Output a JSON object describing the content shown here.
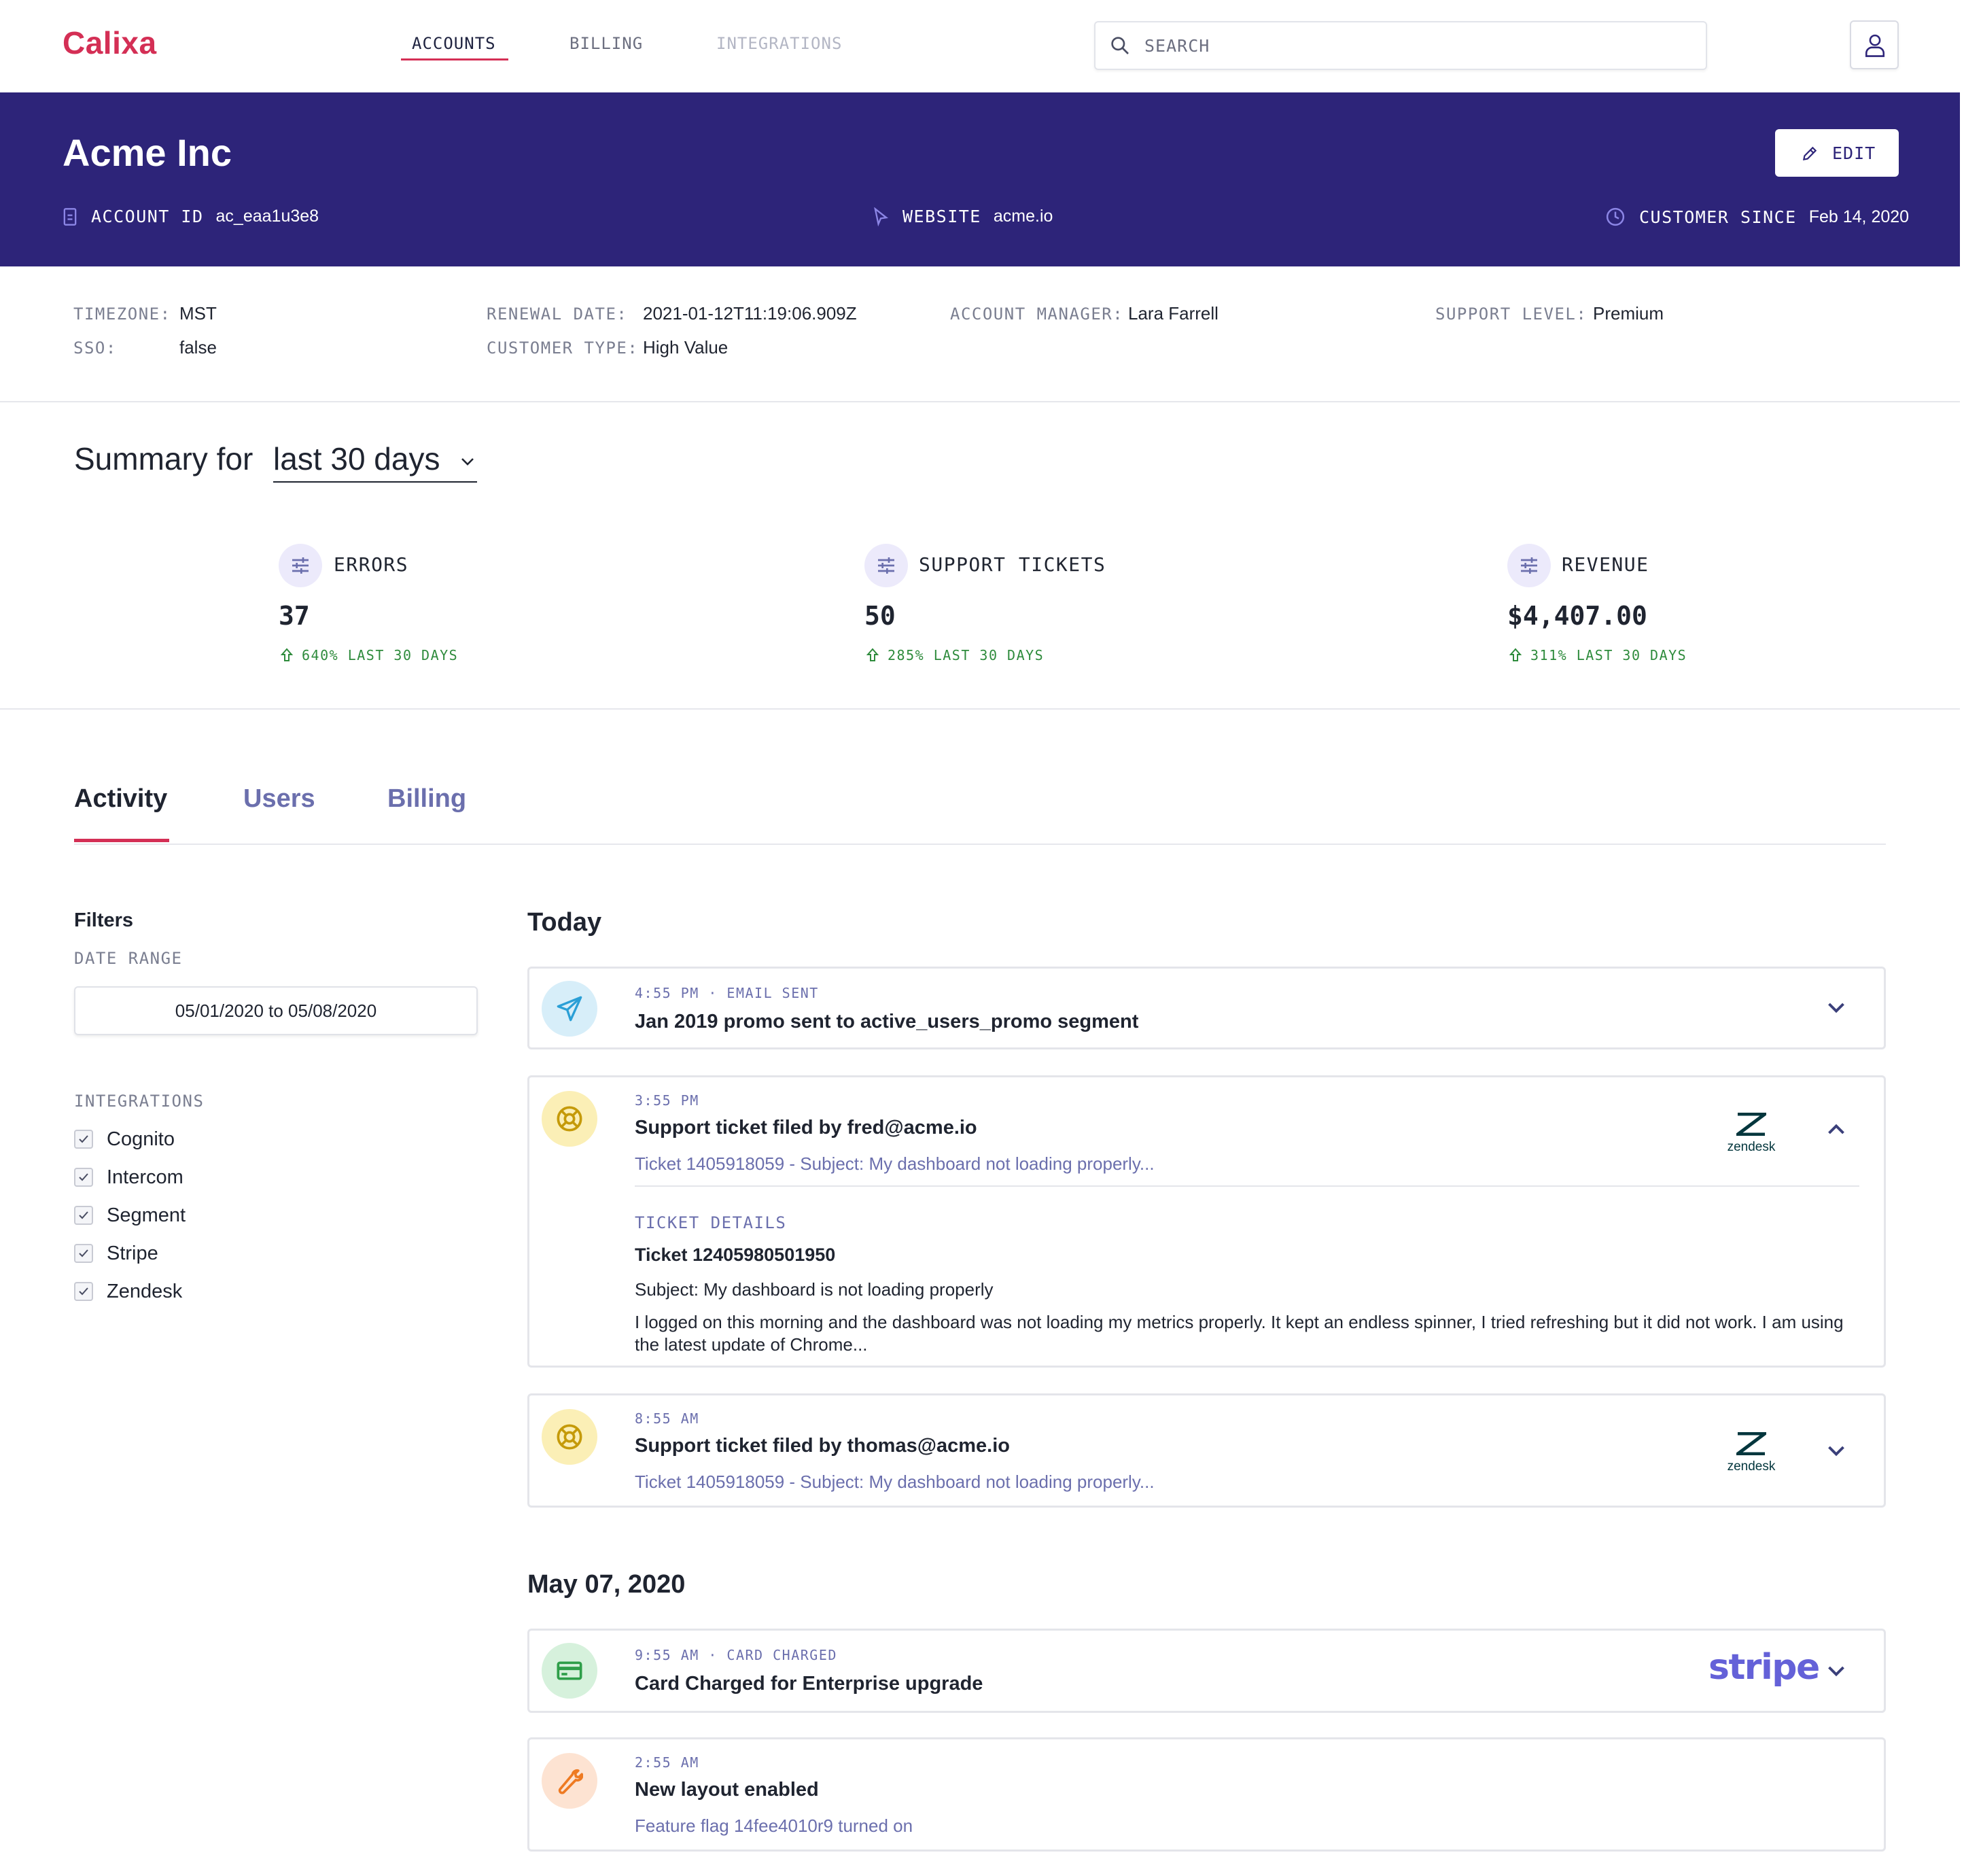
{
  "brand": {
    "name": "Calixa",
    "color": "#d42f55"
  },
  "topnav": {
    "tabs": [
      {
        "label": "ACCOUNTS",
        "state": "active"
      },
      {
        "label": "BILLING",
        "state": "normal"
      },
      {
        "label": "INTEGRATIONS",
        "state": "disabled"
      }
    ],
    "search_placeholder": "SEARCH"
  },
  "account": {
    "name": "Acme Inc",
    "edit_label": "EDIT",
    "id_label": "ACCOUNT ID",
    "id_value": "ac_eaa1u3e8",
    "website_label": "WEBSITE",
    "website_value": "acme.io",
    "since_label": "CUSTOMER SINCE",
    "since_value": "Feb 14, 2020",
    "header_color": "#2d2479"
  },
  "details": {
    "timezone_label": "TIMEZONE:",
    "timezone_value": "MST",
    "sso_label": "SSO:",
    "sso_value": "false",
    "renewal_label": "RENEWAL DATE:",
    "renewal_value": "2021-01-12T11:19:06.909Z",
    "customer_type_label": "CUSTOMER TYPE:",
    "customer_type_value": "High Value",
    "manager_label": "ACCOUNT MANAGER:",
    "manager_value": "Lara Farrell",
    "support_label": "SUPPORT LEVEL:",
    "support_value": "Premium"
  },
  "summary": {
    "title_prefix": "Summary for",
    "range": "last 30 days",
    "stats": [
      {
        "label": "ERRORS",
        "value": "37",
        "delta": "640% LAST 30 DAYS"
      },
      {
        "label": "SUPPORT TICKETS",
        "value": "50",
        "delta": "285% LAST 30 DAYS"
      },
      {
        "label": "REVENUE",
        "value": "$4,407.00",
        "delta": "311% LAST 30 DAYS"
      }
    ]
  },
  "tabs": [
    {
      "label": "Activity",
      "active": true
    },
    {
      "label": "Users",
      "active": false
    },
    {
      "label": "Billing",
      "active": false
    }
  ],
  "filters": {
    "title": "Filters",
    "date_range_label": "DATE RANGE",
    "date_range_value": "05/01/2020 to 05/08/2020",
    "integrations_label": "INTEGRATIONS",
    "integrations": [
      {
        "label": "Cognito",
        "checked": true
      },
      {
        "label": "Intercom",
        "checked": true
      },
      {
        "label": "Segment",
        "checked": true
      },
      {
        "label": "Stripe",
        "checked": true
      },
      {
        "label": "Zendesk",
        "checked": true
      }
    ]
  },
  "feed": {
    "today_label": "Today",
    "may07_label": "May 07, 2020",
    "items": [
      {
        "icon": "paper-plane-icon",
        "meta": "4:55 PM · EMAIL SENT",
        "title": "Jan 2019 promo sent to active_users_promo segment",
        "expanded": false
      },
      {
        "icon": "lifebuoy-icon",
        "meta": "3:55 PM",
        "title": "Support ticket filed by fred@acme.io",
        "sub": "Ticket 1405918059 - Subject: My dashboard not loading properly...",
        "source": "zendesk",
        "expanded": true,
        "details_label": "TICKET DETAILS",
        "ticket_id": "Ticket 12405980501950",
        "subject": "Subject: My dashboard is not loading properly",
        "body": "I logged on this morning and the dashboard was not loading my metrics properly. It kept an endless spinner, I tried refreshing but it did not work. I am using the latest update of Chrome..."
      },
      {
        "icon": "lifebuoy-icon",
        "meta": "8:55 AM",
        "title": "Support ticket filed by thomas@acme.io",
        "sub": "Ticket 1405918059 - Subject: My dashboard not loading properly...",
        "source": "zendesk",
        "expanded": false
      },
      {
        "icon": "credit-card-icon",
        "meta": "9:55 AM · CARD CHARGED",
        "title": "Card Charged for Enterprise upgrade",
        "source": "stripe",
        "expanded": false
      },
      {
        "icon": "wrench-icon",
        "meta": "2:55 AM",
        "title": "New layout enabled",
        "sub": "Feature flag 14fee4010r9 turned on",
        "expanded": false
      }
    ]
  },
  "logos": {
    "zendesk": "zendesk",
    "stripe": "stripe"
  },
  "colors": {
    "accent": "#d42f55",
    "link": "#6b6fad",
    "positive": "#2e8b3c"
  }
}
